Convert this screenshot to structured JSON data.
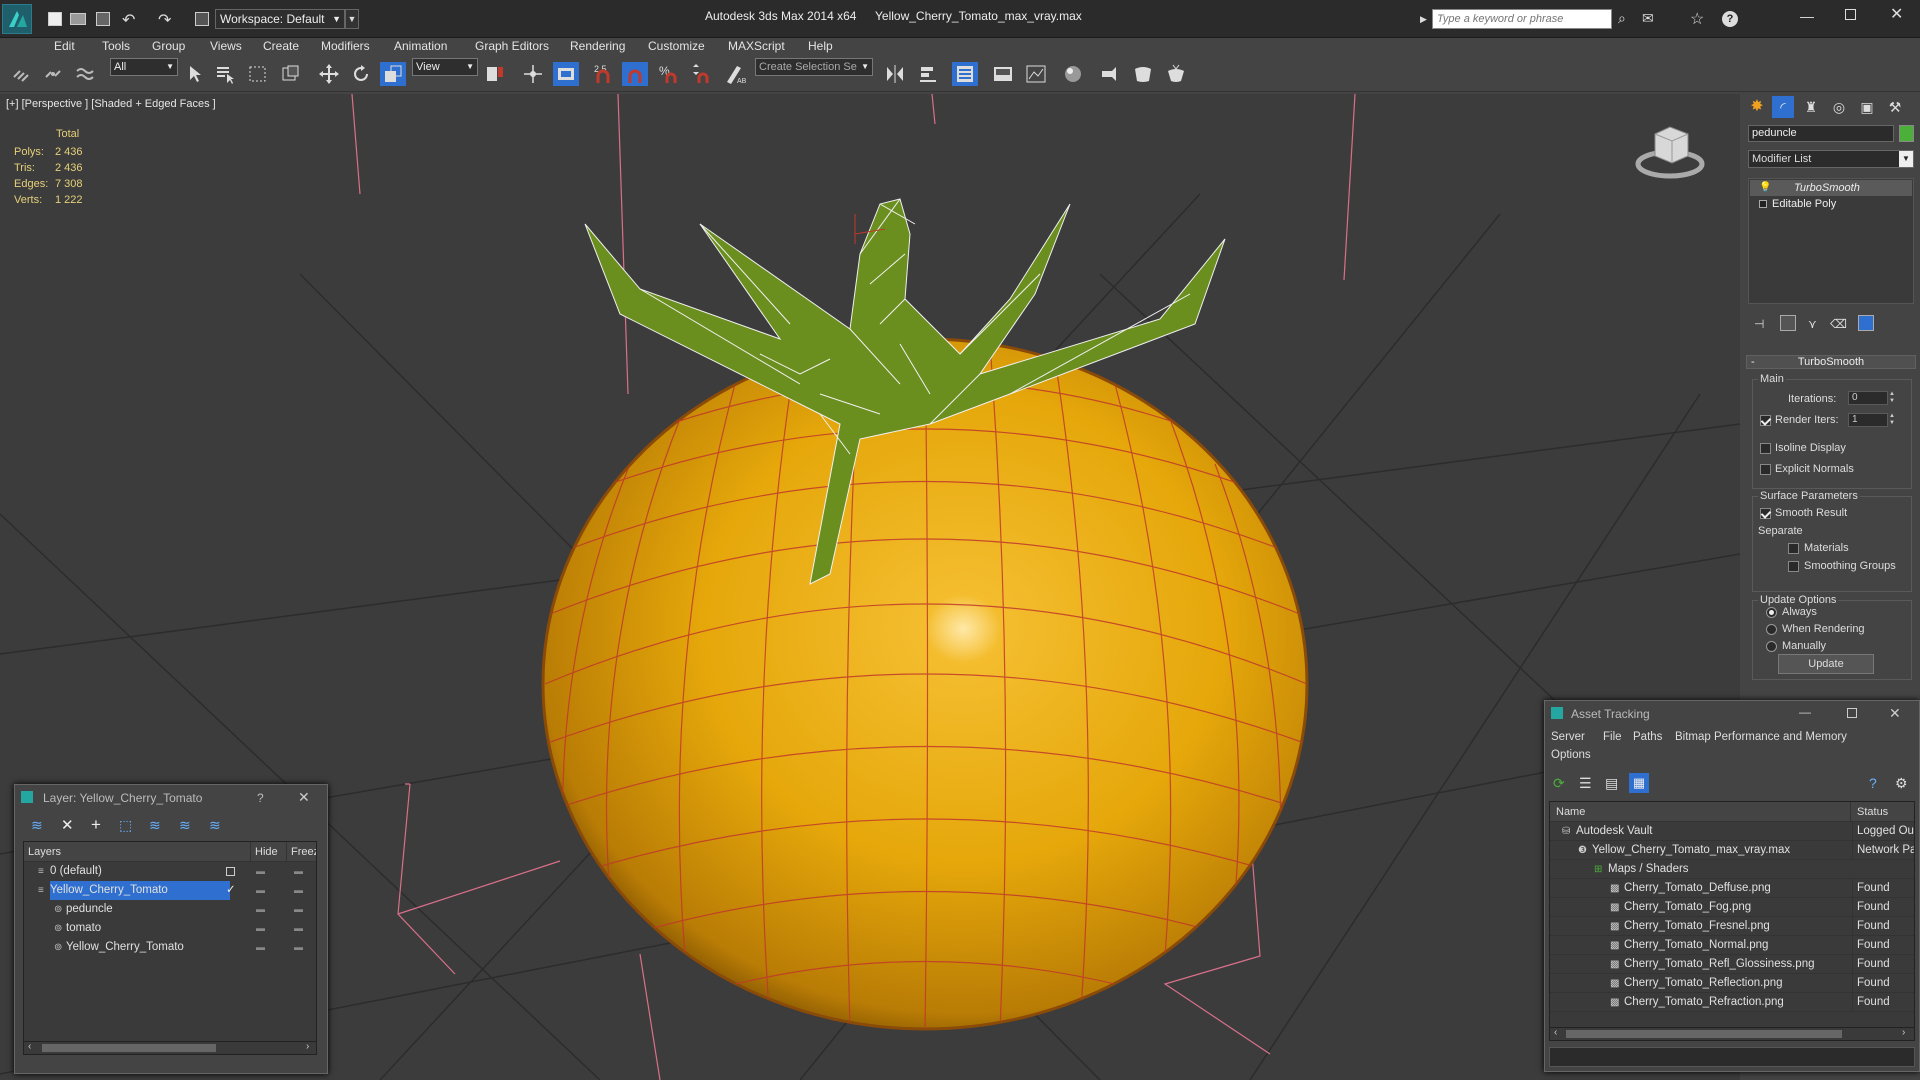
{
  "title": {
    "app": "Autodesk 3ds Max 2014 x64",
    "file": "Yellow_Cherry_Tomato_max_vray.max",
    "workspace": "Workspace: Default",
    "search_placeholder": "Type a keyword or phrase"
  },
  "menu": [
    "Edit",
    "Tools",
    "Group",
    "Views",
    "Create",
    "Modifiers",
    "Animation",
    "Graph Editors",
    "Rendering",
    "Customize",
    "MAXScript",
    "Help"
  ],
  "toolbar": {
    "selection_filter": "All",
    "ref_coord": "View",
    "snap_value": "2.5",
    "named_selection": "Create Selection Se"
  },
  "viewport": {
    "label": "[+] [Perspective ] [Shaded + Edged Faces ]",
    "stats_header": "Total",
    "stats": [
      {
        "label": "Polys:",
        "value": "2 436"
      },
      {
        "label": "Tris:",
        "value": "2 436"
      },
      {
        "label": "Edges:",
        "value": "7 308"
      },
      {
        "label": "Verts:",
        "value": "1 222"
      }
    ]
  },
  "command_panel": {
    "object_name": "peduncle",
    "object_color": "#4caf3a",
    "modifier_list": "Modifier List",
    "stack": [
      "TurboSmooth",
      "Editable Poly"
    ],
    "rollout_title": "TurboSmooth",
    "main_label": "Main",
    "iterations_label": "Iterations:",
    "iterations_value": "0",
    "render_iters_label": "Render Iters:",
    "render_iters_value": "1",
    "isoline": "Isoline Display",
    "explicit_normals": "Explicit Normals",
    "surface_params": "Surface Parameters",
    "smooth_result": "Smooth Result",
    "separate": "Separate",
    "materials": "Materials",
    "smoothing_groups": "Smoothing Groups",
    "update_options": "Update Options",
    "always": "Always",
    "when_rendering": "When Rendering",
    "manually": "Manually",
    "update_button": "Update"
  },
  "layer_window": {
    "title": "Layer: Yellow_Cherry_Tomato",
    "help": "?",
    "col_layers": "Layers",
    "col_hide": "Hide",
    "col_freeze": "Freeze",
    "rows": [
      {
        "name": "0 (default)",
        "indent": 1,
        "selected": false
      },
      {
        "name": "Yellow_Cherry_Tomato",
        "indent": 1,
        "selected": true
      },
      {
        "name": "peduncle",
        "indent": 2,
        "selected": false
      },
      {
        "name": "tomato",
        "indent": 2,
        "selected": false
      },
      {
        "name": "Yellow_Cherry_Tomato",
        "indent": 2,
        "selected": false
      }
    ]
  },
  "asset_window": {
    "title": "Asset Tracking",
    "menu": [
      "Server",
      "File",
      "Paths",
      "Bitmap Performance and Memory"
    ],
    "menu2": "Options",
    "col_name": "Name",
    "col_status": "Status",
    "rows": [
      {
        "name": "Autodesk Vault",
        "status": "Logged Ou",
        "indent": 1
      },
      {
        "name": "Yellow_Cherry_Tomato_max_vray.max",
        "status": "Network Pa",
        "indent": 2
      },
      {
        "name": "Maps / Shaders",
        "status": "",
        "indent": 3
      },
      {
        "name": "Cherry_Tomato_Deffuse.png",
        "status": "Found",
        "indent": 4
      },
      {
        "name": "Cherry_Tomato_Fog.png",
        "status": "Found",
        "indent": 4
      },
      {
        "name": "Cherry_Tomato_Fresnel.png",
        "status": "Found",
        "indent": 4
      },
      {
        "name": "Cherry_Tomato_Normal.png",
        "status": "Found",
        "indent": 4
      },
      {
        "name": "Cherry_Tomato_Refl_Glossiness.png",
        "status": "Found",
        "indent": 4
      },
      {
        "name": "Cherry_Tomato_Reflection.png",
        "status": "Found",
        "indent": 4
      },
      {
        "name": "Cherry_Tomato_Refraction.png",
        "status": "Found",
        "indent": 4
      }
    ]
  },
  "colors": {
    "tomato": "#e8a90c",
    "wire": "#c0392b",
    "leaf": "#6b8f1e",
    "selection": "#2f6fd0"
  }
}
